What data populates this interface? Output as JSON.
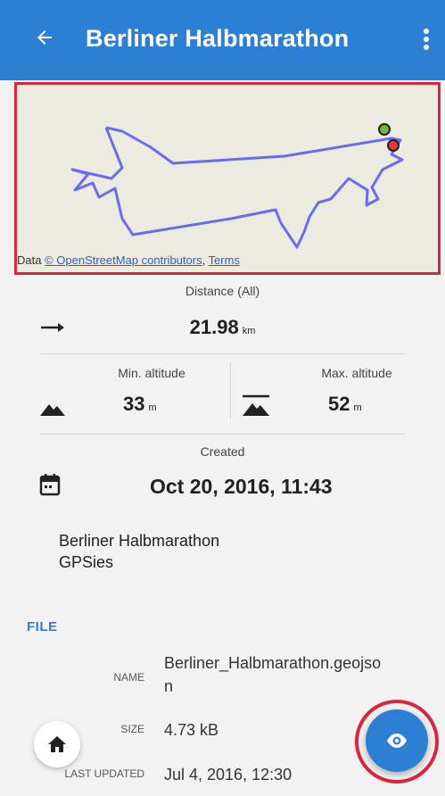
{
  "appbar": {
    "title": "Berliner Halbmarathon",
    "back_icon": "arrow-left-icon",
    "menu_icon": "more-vertical-icon",
    "color": "#2d7fd4"
  },
  "map": {
    "attribution_prefix": "Data ",
    "attribution_link": "© OpenStreetMap contributors",
    "attribution_sep": ", ",
    "terms_link": "Terms",
    "route_color": "#6b6bf0",
    "start_color": "#7cb342",
    "end_color": "#e53935"
  },
  "stats": {
    "distance_label": "Distance (All)",
    "distance_value": "21.98",
    "distance_unit": "km",
    "min_alt_label": "Min. altitude",
    "min_alt_value": "33",
    "min_alt_unit": "m",
    "max_alt_label": "Max. altitude",
    "max_alt_value": "52",
    "max_alt_unit": "m",
    "created_label": "Created",
    "created_value": "Oct 20, 2016, 11:43"
  },
  "description": {
    "line1": "Berliner Halbmarathon",
    "line2": "GPSies"
  },
  "file": {
    "header": "FILE",
    "name_key": "NAME",
    "name_line1": "Berliner_Halbmarathon.geojso",
    "name_line2": "n",
    "size_key": "SIZE",
    "size_value": "4.73 kB",
    "updated_key": "LAST UPDATED",
    "updated_value": "Jul 4, 2016, 12:30"
  },
  "buttons": {
    "home_icon": "home-icon",
    "fab_icon": "eye-icon",
    "highlight_color": "#d7263d"
  }
}
